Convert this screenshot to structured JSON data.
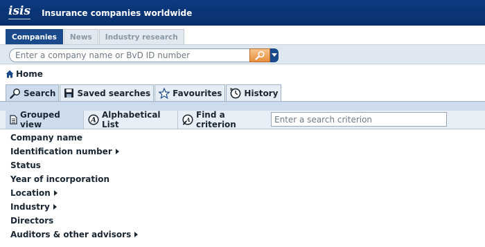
{
  "header": {
    "logo": "isis",
    "title": "Insurance companies worldwide"
  },
  "top_tabs": [
    {
      "label": "Companies",
      "active": true
    },
    {
      "label": "News",
      "active": false
    },
    {
      "label": "Industry research",
      "active": false
    }
  ],
  "search": {
    "placeholder": "Enter a company name or BvD ID number",
    "button_icon": "search-icon",
    "dropdown_icon": "chevron-down-icon"
  },
  "breadcrumb": {
    "home_label": "Home",
    "icon": "home-icon"
  },
  "main_tabs": [
    {
      "label": "Search",
      "icon": "magnifier-icon",
      "active": true
    },
    {
      "label": "Saved searches",
      "icon": "floppy-disk-icon",
      "active": false
    },
    {
      "label": "Favourites",
      "icon": "star-icon",
      "active": false
    },
    {
      "label": "History",
      "icon": "clock-icon",
      "active": false
    }
  ],
  "sub_tabs": [
    {
      "label": "Grouped view",
      "icon": "document-icon",
      "active": true
    },
    {
      "label": "Alphabetical List",
      "icon": "letter-a-icon",
      "active": false
    },
    {
      "label": "Find a criterion",
      "icon": "find-icon",
      "active": false
    }
  ],
  "criterion_search": {
    "placeholder": "Enter a search criterion"
  },
  "criteria": [
    {
      "label": "Company name",
      "expandable": false
    },
    {
      "label": "Identification number",
      "expandable": true
    },
    {
      "label": "Status",
      "expandable": false
    },
    {
      "label": "Year of incorporation",
      "expandable": false
    },
    {
      "label": "Location",
      "expandable": true
    },
    {
      "label": "Industry",
      "expandable": true
    },
    {
      "label": "Directors",
      "expandable": false
    },
    {
      "label": "Auditors & other advisors",
      "expandable": true
    }
  ],
  "colors": {
    "header_bg": "#0c3a80",
    "active_tab": "#1b4a8c",
    "search_button": "#e88e3c",
    "tab_bg": "#cddcec"
  }
}
